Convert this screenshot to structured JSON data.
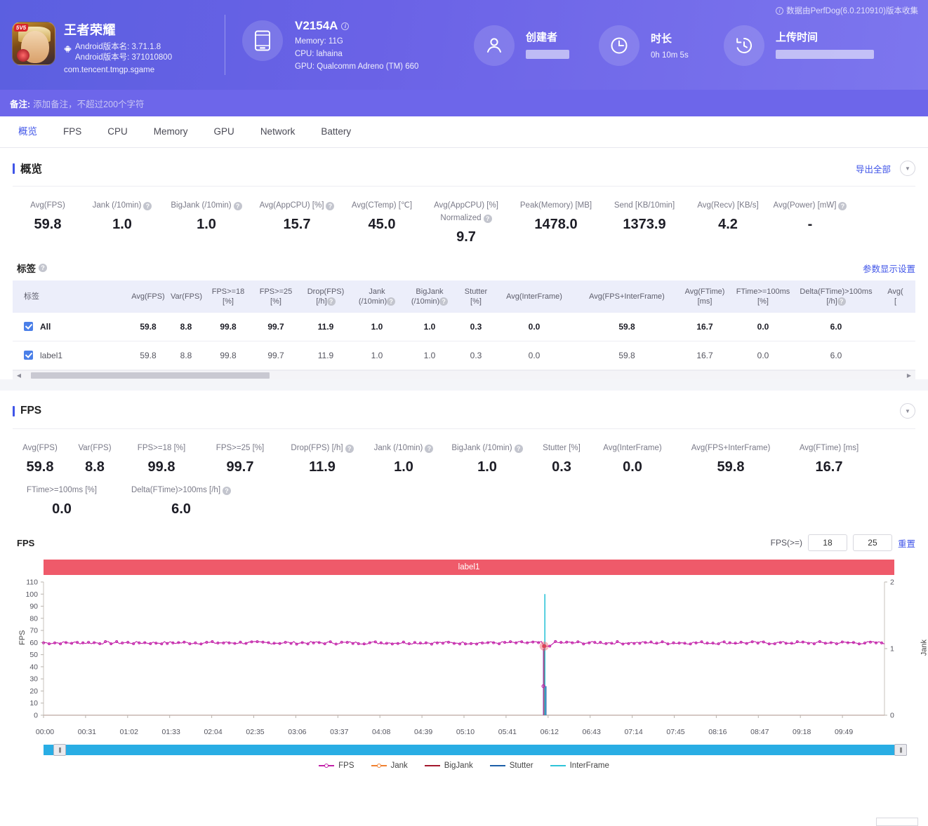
{
  "header": {
    "perfdog_note": "数据由PerfDog(6.0.210910)版本收集",
    "app": {
      "name": "王者荣耀",
      "version_name": "Android版本名: 3.71.1.8",
      "version_code": "Android版本号: 371010800",
      "package": "com.tencent.tmgp.sgame"
    },
    "device": {
      "model": "V2154A",
      "memory": "Memory: 11G",
      "cpu": "CPU: lahaina",
      "gpu": "GPU: Qualcomm Adreno (TM) 660"
    },
    "creator": {
      "title": "创建者",
      "value": ""
    },
    "duration": {
      "title": "时长",
      "value": "0h 10m 5s"
    },
    "upload_time": {
      "title": "上传时间",
      "value": ""
    }
  },
  "notebar": {
    "label": "备注:",
    "placeholder": "添加备注，不超过200个字符"
  },
  "tabs": [
    {
      "label": "概览",
      "active": true
    },
    {
      "label": "FPS",
      "active": false
    },
    {
      "label": "CPU",
      "active": false
    },
    {
      "label": "Memory",
      "active": false
    },
    {
      "label": "GPU",
      "active": false
    },
    {
      "label": "Network",
      "active": false
    },
    {
      "label": "Battery",
      "active": false
    }
  ],
  "overview": {
    "title": "概览",
    "export_all": "导出全部",
    "metrics": [
      {
        "label": "Avg(FPS)",
        "help": false,
        "value": "59.8"
      },
      {
        "label": "Jank (/10min)",
        "help": true,
        "value": "1.0"
      },
      {
        "label": "BigJank (/10min)",
        "help": true,
        "value": "1.0"
      },
      {
        "label": "Avg(AppCPU) [%]",
        "help": true,
        "value": "15.7"
      },
      {
        "label": "Avg(CTemp) [℃]",
        "help": false,
        "value": "45.0"
      },
      {
        "label": "Avg(AppCPU) [%] Normalized",
        "help": true,
        "value": "9.7"
      },
      {
        "label": "Peak(Memory) [MB]",
        "help": false,
        "value": "1478.0"
      },
      {
        "label": "Send [KB/10min]",
        "help": false,
        "value": "1373.9"
      },
      {
        "label": "Avg(Recv) [KB/s]",
        "help": false,
        "value": "4.2"
      },
      {
        "label": "Avg(Power) [mW]",
        "help": true,
        "value": "-"
      }
    ]
  },
  "labels_table": {
    "title": "标签",
    "settings_link": "参数显示设置",
    "columns": [
      {
        "l1": "标签",
        "l2": "",
        "help": false
      },
      {
        "l1": "Avg(FPS)",
        "l2": "",
        "help": false
      },
      {
        "l1": "Var(FPS)",
        "l2": "",
        "help": false
      },
      {
        "l1": "FPS>=18",
        "l2": "[%]",
        "help": false
      },
      {
        "l1": "FPS>=25",
        "l2": "[%]",
        "help": false
      },
      {
        "l1": "Drop(FPS)",
        "l2": "[/h]",
        "help": true
      },
      {
        "l1": "Jank",
        "l2": "(/10min)",
        "help": true
      },
      {
        "l1": "BigJank",
        "l2": "(/10min)",
        "help": true
      },
      {
        "l1": "Stutter",
        "l2": "[%]",
        "help": false
      },
      {
        "l1": "Avg(InterFrame)",
        "l2": "",
        "help": false
      },
      {
        "l1": "Avg(FPS+InterFrame)",
        "l2": "",
        "help": false
      },
      {
        "l1": "Avg(FTime)",
        "l2": "[ms]",
        "help": false
      },
      {
        "l1": "FTime>=100ms",
        "l2": "[%]",
        "help": false
      },
      {
        "l1": "Delta(FTime)>100ms",
        "l2": "[/h]",
        "help": true
      },
      {
        "l1": "Avg(",
        "l2": "[",
        "help": false
      }
    ],
    "rows": [
      {
        "checked": true,
        "label": "All",
        "values": [
          "59.8",
          "8.8",
          "99.8",
          "99.7",
          "11.9",
          "1.0",
          "1.0",
          "0.3",
          "0.0",
          "59.8",
          "16.7",
          "0.0",
          "6.0",
          ""
        ]
      },
      {
        "checked": true,
        "label": "label1",
        "values": [
          "59.8",
          "8.8",
          "99.8",
          "99.7",
          "11.9",
          "1.0",
          "1.0",
          "0.3",
          "0.0",
          "59.8",
          "16.7",
          "0.0",
          "6.0",
          ""
        ]
      }
    ]
  },
  "fps_section": {
    "title": "FPS",
    "metrics_row1": [
      {
        "label": "Avg(FPS)",
        "help": false,
        "value": "59.8"
      },
      {
        "label": "Var(FPS)",
        "help": false,
        "value": "8.8"
      },
      {
        "label": "FPS>=18 [%]",
        "help": false,
        "value": "99.8"
      },
      {
        "label": "FPS>=25 [%]",
        "help": false,
        "value": "99.7"
      },
      {
        "label": "Drop(FPS) [/h]",
        "help": true,
        "value": "11.9"
      },
      {
        "label": "Jank (/10min)",
        "help": true,
        "value": "1.0"
      },
      {
        "label": "BigJank (/10min)",
        "help": true,
        "value": "1.0"
      },
      {
        "label": "Stutter [%]",
        "help": false,
        "value": "0.3"
      },
      {
        "label": "Avg(InterFrame)",
        "help": false,
        "value": "0.0"
      },
      {
        "label": "Avg(FPS+InterFrame)",
        "help": false,
        "value": "59.8"
      },
      {
        "label": "Avg(FTime) [ms]",
        "help": false,
        "value": "16.7"
      }
    ],
    "metrics_row2": [
      {
        "label": "FTime>=100ms [%]",
        "help": false,
        "value": "0.0"
      },
      {
        "label": "Delta(FTime)>100ms [/h]",
        "help": true,
        "value": "6.0"
      }
    ],
    "chart_controls": {
      "title": "FPS",
      "threshold_label": "FPS(>=)",
      "threshold_low": "18",
      "threshold_high": "25",
      "reset_label": "重置"
    },
    "label_band": "label1"
  },
  "chart_data": {
    "type": "line",
    "title": "FPS",
    "xlabel": "",
    "ylabel": "FPS",
    "y2label": "Jank",
    "ylim": [
      0,
      110
    ],
    "y2lim": [
      0,
      2
    ],
    "yticks": [
      0,
      10,
      20,
      30,
      40,
      50,
      60,
      70,
      80,
      90,
      100,
      110
    ],
    "y2ticks": [
      0,
      1,
      2
    ],
    "xticks": [
      "00:00",
      "00:31",
      "01:02",
      "01:33",
      "02:04",
      "02:35",
      "03:06",
      "03:37",
      "04:08",
      "04:39",
      "05:10",
      "05:41",
      "06:12",
      "06:43",
      "07:14",
      "07:45",
      "08:16",
      "08:47",
      "09:18",
      "09:49"
    ],
    "grid": false,
    "legend_position": "bottom",
    "legend": [
      "FPS",
      "Jank",
      "BigJank",
      "Stutter",
      "InterFrame"
    ],
    "series": [
      {
        "name": "FPS",
        "color": "#c220a8",
        "axis": "left",
        "baseline": 59.8,
        "noise": 2.2,
        "marker": "circle"
      },
      {
        "name": "Jank",
        "color": "#f08030",
        "axis": "right",
        "baseline": 0,
        "spike_at": "06:35",
        "spike_value": 1,
        "marker": "circle"
      },
      {
        "name": "BigJank",
        "color": "#a3172c",
        "axis": "right",
        "baseline": 0,
        "spike_at": "06:35",
        "spike_value": 1,
        "marker": "none"
      },
      {
        "name": "Stutter",
        "color": "#1c5fa8",
        "axis": "left",
        "baseline": 0,
        "spike_at": "06:35",
        "spike_value": 24,
        "marker": "none"
      },
      {
        "name": "InterFrame",
        "color": "#2ec4d8",
        "axis": "left",
        "baseline": 0,
        "spike_at": "06:35",
        "spike_value": 100,
        "marker": "none"
      }
    ],
    "annotations": [
      {
        "label": "label1",
        "type": "span-band",
        "color": "#ef5a6a",
        "from": "00:00",
        "to": "09:59"
      },
      {
        "label": "highlight",
        "type": "point",
        "x": "06:35",
        "y": 57,
        "color": "#ef5a6a"
      }
    ]
  },
  "timeline_slider": {
    "left_handle": "|||",
    "right_handle": "|||"
  }
}
